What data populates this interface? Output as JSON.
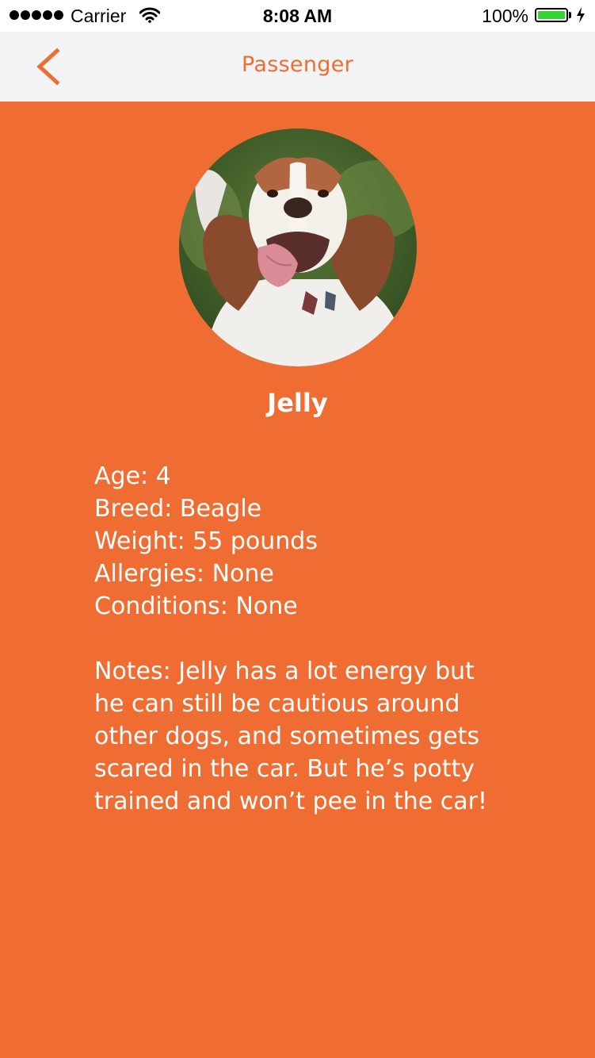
{
  "colors": {
    "accent": "#ef6d32",
    "nav_background": "#f2f3f4",
    "battery_fill": "#33d633"
  },
  "status_bar": {
    "carrier": "Carrier",
    "time": "8:08 AM",
    "battery_percent": "100%",
    "battery_level": 1.0,
    "icons": [
      "signal-dots-icon",
      "wifi-icon",
      "battery-icon",
      "charging-bolt-icon"
    ]
  },
  "nav": {
    "back_icon": "chevron-left-icon",
    "title": "Passenger"
  },
  "profile": {
    "photo_icon": "dog-photo",
    "name": "Jelly",
    "details": {
      "age": "Age: 4",
      "breed": "Breed: Beagle",
      "weight": "Weight: 55 pounds",
      "allergies": "Allergies: None",
      "conditions": "Conditions: None"
    },
    "notes": "Notes: Jelly has a lot energy but he can still be cautious around other dogs, and sometimes gets scared in the car. But he’s potty trained and won’t pee in the car!"
  }
}
